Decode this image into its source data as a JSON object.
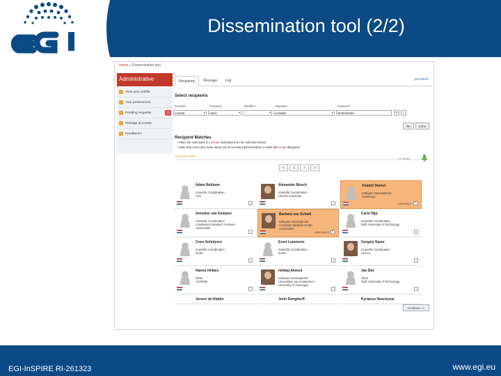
{
  "slide": {
    "title": "Dissemination tool (2/2)",
    "footer_left": "EGI-InSPIRE RI-261323",
    "footer_right": "www.egi.eu",
    "colors": {
      "brand_blue": "#0c4a86",
      "admin_red": "#c0392b",
      "selected_orange": "#f7b67b"
    }
  },
  "app": {
    "breadcrumb_home": "Home",
    "breadcrumb_current": "» Dissemination tool",
    "admin_title": "Administrative",
    "sidebar": [
      {
        "label": "View your profile",
        "icon": "profile-icon"
      },
      {
        "label": "Your preferences",
        "icon": "preferences-icon"
      },
      {
        "label": "Pending requests",
        "icon": "requests-icon",
        "badge": "2"
      },
      {
        "label": "Manage accounts",
        "icon": "accounts-icon"
      },
      {
        "label": "Feedback?",
        "icon": "feedback-icon"
      }
    ],
    "tabs": [
      "Recipients",
      "Message",
      "Log"
    ],
    "tab_help": "permalink",
    "select_title": "Select recipients",
    "columns": [
      "Context",
      "Property",
      "Modifier",
      "Operator",
      "Keyword"
    ],
    "filter": {
      "context": "country",
      "property": "name",
      "modifier": "",
      "operator": "contains",
      "keyword": "Netherlands"
    },
    "ok_label": "OK",
    "clear_label": "Clear",
    "matches_title": "Recipient Matches",
    "bullet1_pre": "Filter the selections to",
    "bullet1_hl": "exclude",
    "bullet1_post": "individual from the selection below",
    "bullet2_pre": "Note that users who have opted out of receiving dissemination e-mails will",
    "bullet2_hl": "not",
    "bullet2_post": "be displayed",
    "advanced_label": "Advanced filter",
    "results_label": "27 results",
    "pager": [
      "«",
      "1",
      "2",
      "»"
    ],
    "continue_label": "Continue »»",
    "recipients": [
      {
        "name": "Adam Belloum",
        "role": "Scientific Coordination\nUvA"
      },
      {
        "name": "Alexander Bosch",
        "role": "Scientific Coordination\nUtrecht University"
      },
      {
        "name": "Anatoli Danezi",
        "role": "Software Development\nSURFsara",
        "tag": "ANNOUNCE",
        "selected": true,
        "checked": true
      },
      {
        "name": "Annelise van Kempen",
        "role": "Scientific Coordination\nAcademisch Medisch Centrum\nAmsterdam"
      },
      {
        "name": "Barbera van Schaik",
        "role": "Software Development\nAcademic Medical Center,\nAmsterdam",
        "tag": "ANNOUNCE",
        "selected": true,
        "checked": true
      },
      {
        "name": "Carlo Nijp",
        "role": "Scientific Coordination\nDelft University of Technology"
      },
      {
        "name": "Coen Schrijvers",
        "role": "Scientific Coordination\nSARA"
      },
      {
        "name": "Evert Lammerts",
        "role": "Scientific Coordination\nSARA"
      },
      {
        "name": "Gergely Sipos",
        "role": "Scientific Coordination\nEGI.eu"
      },
      {
        "name": "Hanno Holties",
        "role": "Other\nASTRON"
      },
      {
        "name": "Ishtiaq Ahmed",
        "role": "Software Development\nUniversiteit van Amsterdam /\nUniversity of Groningen"
      },
      {
        "name": "Jan Bot",
        "role": "Other\nDelft University of Technology"
      },
      {
        "name": "Jeroen de Ridder",
        "role": ""
      },
      {
        "name": "Jorin Dongdorff",
        "role": ""
      },
      {
        "name": "Kyriacos Neocleous",
        "role": ""
      }
    ]
  }
}
